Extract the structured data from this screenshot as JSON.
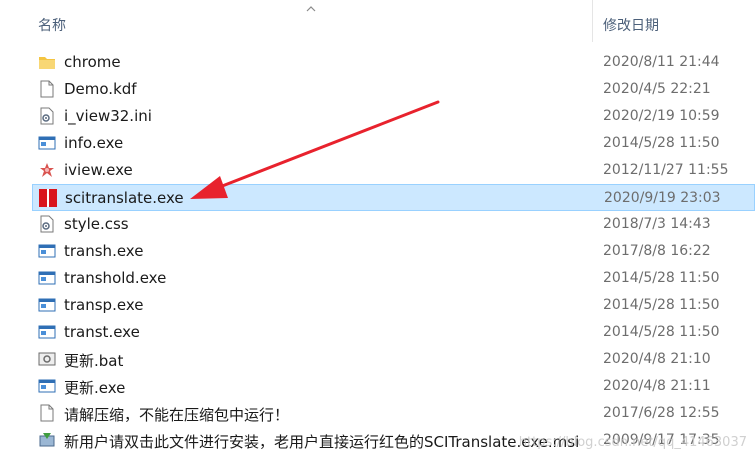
{
  "header": {
    "name_label": "名称",
    "date_label": "修改日期"
  },
  "files": [
    {
      "icon": "folder-icon",
      "name": "chrome",
      "date": "2020/8/11 21:44"
    },
    {
      "icon": "file-icon",
      "name": "Demo.kdf",
      "date": "2020/4/5 22:21"
    },
    {
      "icon": "settings-file-icon",
      "name": "i_view32.ini",
      "date": "2020/2/19 10:59"
    },
    {
      "icon": "window-app-icon",
      "name": "info.exe",
      "date": "2014/5/28 11:50"
    },
    {
      "icon": "iview-app-icon",
      "name": "iview.exe",
      "date": "2012/11/27 11:55"
    },
    {
      "icon": "red-app-icon",
      "name": "scitranslate.exe",
      "date": "2020/9/19 23:03",
      "selected": true
    },
    {
      "icon": "settings-file-icon",
      "name": "style.css",
      "date": "2018/7/3 14:43"
    },
    {
      "icon": "window-app-icon",
      "name": "transh.exe",
      "date": "2017/8/8 16:22"
    },
    {
      "icon": "window-app-icon",
      "name": "transhold.exe",
      "date": "2014/5/28 11:50"
    },
    {
      "icon": "window-app-icon",
      "name": "transp.exe",
      "date": "2014/5/28 11:50"
    },
    {
      "icon": "window-app-icon",
      "name": "transt.exe",
      "date": "2014/5/28 11:50"
    },
    {
      "icon": "batch-file-icon",
      "name": "更新.bat",
      "date": "2020/4/8 21:10"
    },
    {
      "icon": "window-app-icon",
      "name": "更新.exe",
      "date": "2020/4/8 21:11"
    },
    {
      "icon": "file-icon",
      "name": "请解压缩，不能在压缩包中运行！",
      "date": "2017/6/28 12:55"
    },
    {
      "icon": "installer-icon",
      "name": "新用户请双击此文件进行安装，老用户直接运行红色的SCITranslate.exe.msi",
      "date": "2009/9/17 17:35"
    }
  ],
  "colors": {
    "selected_bg": "#cce8ff",
    "arrow": "#e8222d",
    "folder": "#f4c542"
  },
  "watermark": "https://blog.csdn.net/qq_41463037"
}
